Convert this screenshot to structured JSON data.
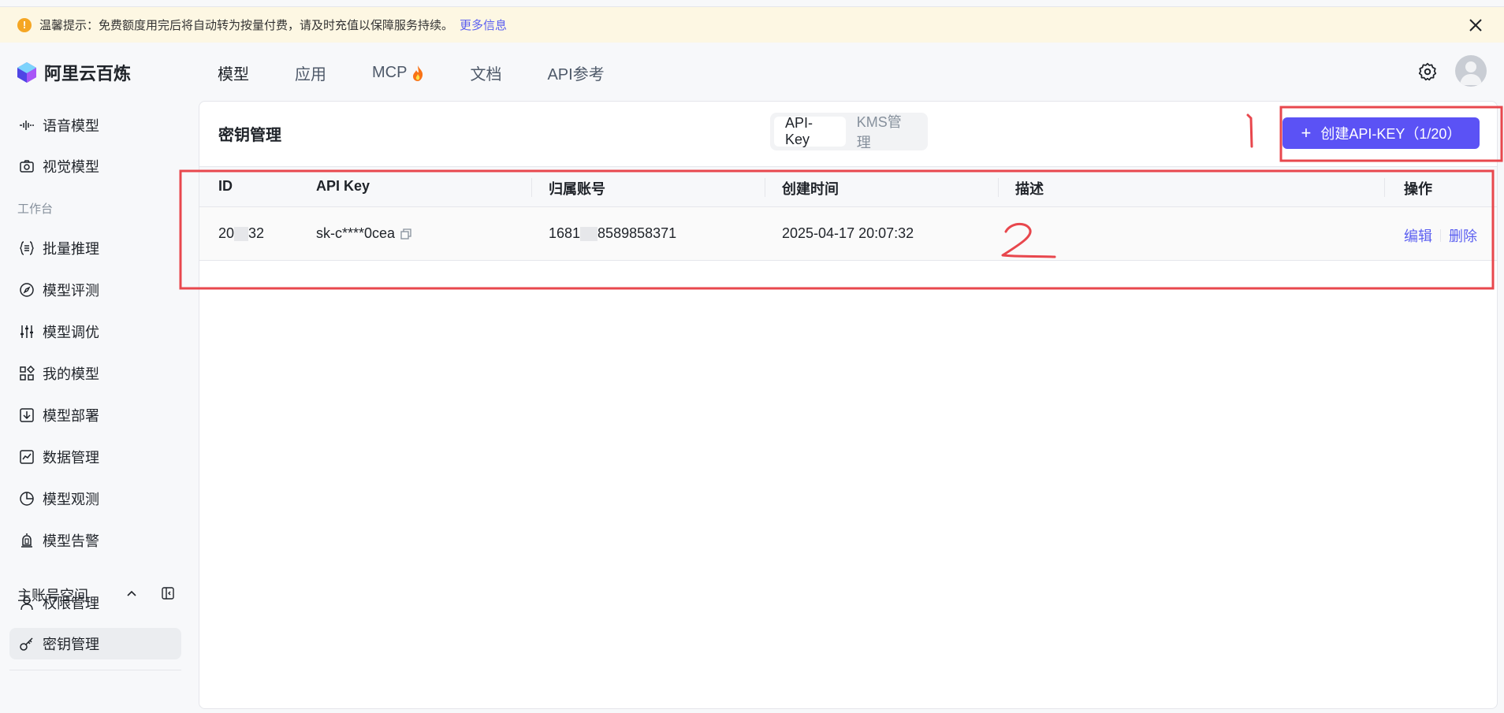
{
  "notice": {
    "text": "温馨提示：免费额度用完后将自动转为按量付费，请及时充值以保障服务持续。",
    "link": "更多信息",
    "warn_glyph": "!"
  },
  "brand": {
    "name": "阿里云百炼"
  },
  "nav": {
    "items": [
      {
        "label": "模型"
      },
      {
        "label": "应用"
      },
      {
        "label": "MCP"
      },
      {
        "label": "文档"
      },
      {
        "label": "API参考"
      }
    ]
  },
  "sidebar": {
    "items": [
      {
        "label": "语音模型",
        "icon": "waveform-icon"
      },
      {
        "label": "视觉模型",
        "icon": "camera-icon"
      },
      {
        "label": "批量推理",
        "icon": "batch-icon"
      },
      {
        "label": "模型评测",
        "icon": "compass-icon"
      },
      {
        "label": "模型调优",
        "icon": "sliders-icon"
      },
      {
        "label": "我的模型",
        "icon": "grid-icon"
      },
      {
        "label": "模型部署",
        "icon": "deploy-icon"
      },
      {
        "label": "数据管理",
        "icon": "chart-icon"
      },
      {
        "label": "模型观测",
        "icon": "pie-icon"
      },
      {
        "label": "模型告警",
        "icon": "alarm-icon"
      },
      {
        "label": "权限管理",
        "icon": "user-icon"
      },
      {
        "label": "密钥管理",
        "icon": "key-icon"
      }
    ],
    "section_label": "工作台",
    "workspace": "主账号空间"
  },
  "panel": {
    "title": "密钥管理",
    "tabs": [
      {
        "label": "API-Key"
      },
      {
        "label": "KMS管理"
      }
    ],
    "create_button": "创建API-KEY（1/20）"
  },
  "table": {
    "columns": [
      "ID",
      "API Key",
      "归属账号",
      "创建时间",
      "描述",
      "操作"
    ],
    "row": {
      "id_prefix": "20",
      "id_suffix": "32",
      "api_key": "sk-c****0cea",
      "account_prefix": "1681",
      "account_suffix": "8589858371",
      "created": "2025-04-17 20:07:32",
      "description": "",
      "edit": "编辑",
      "delete": "删除"
    }
  },
  "annotations": {
    "mark_1": "1",
    "mark_2": "2",
    "color": "#e8474d"
  },
  "colors": {
    "accent": "#5b52f5",
    "link": "#5b5ff0",
    "notice_bg": "#fdf7e3"
  }
}
